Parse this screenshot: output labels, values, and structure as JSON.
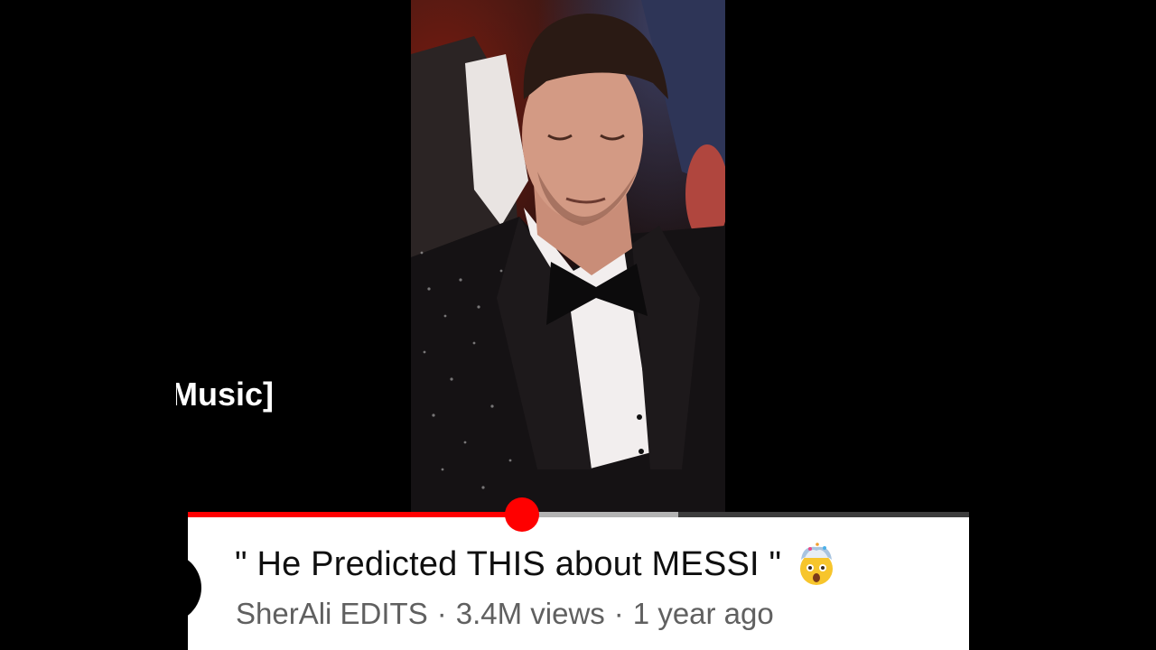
{
  "overlay": {
    "caption": "Music]"
  },
  "player": {
    "progress_fraction": 0.428,
    "buffered_fraction": 0.628,
    "colors": {
      "played": "#ff0000",
      "buffered": "#b3b3b3",
      "track": "#3d3d3d"
    }
  },
  "video": {
    "title": "\" He Predicted THIS about MESSI \"",
    "title_emoji_icon": "exploding-head-emoji-icon",
    "channel": "SherAli EDITS",
    "separator": "·",
    "views": "3.4M views",
    "age": "1 year ago"
  }
}
